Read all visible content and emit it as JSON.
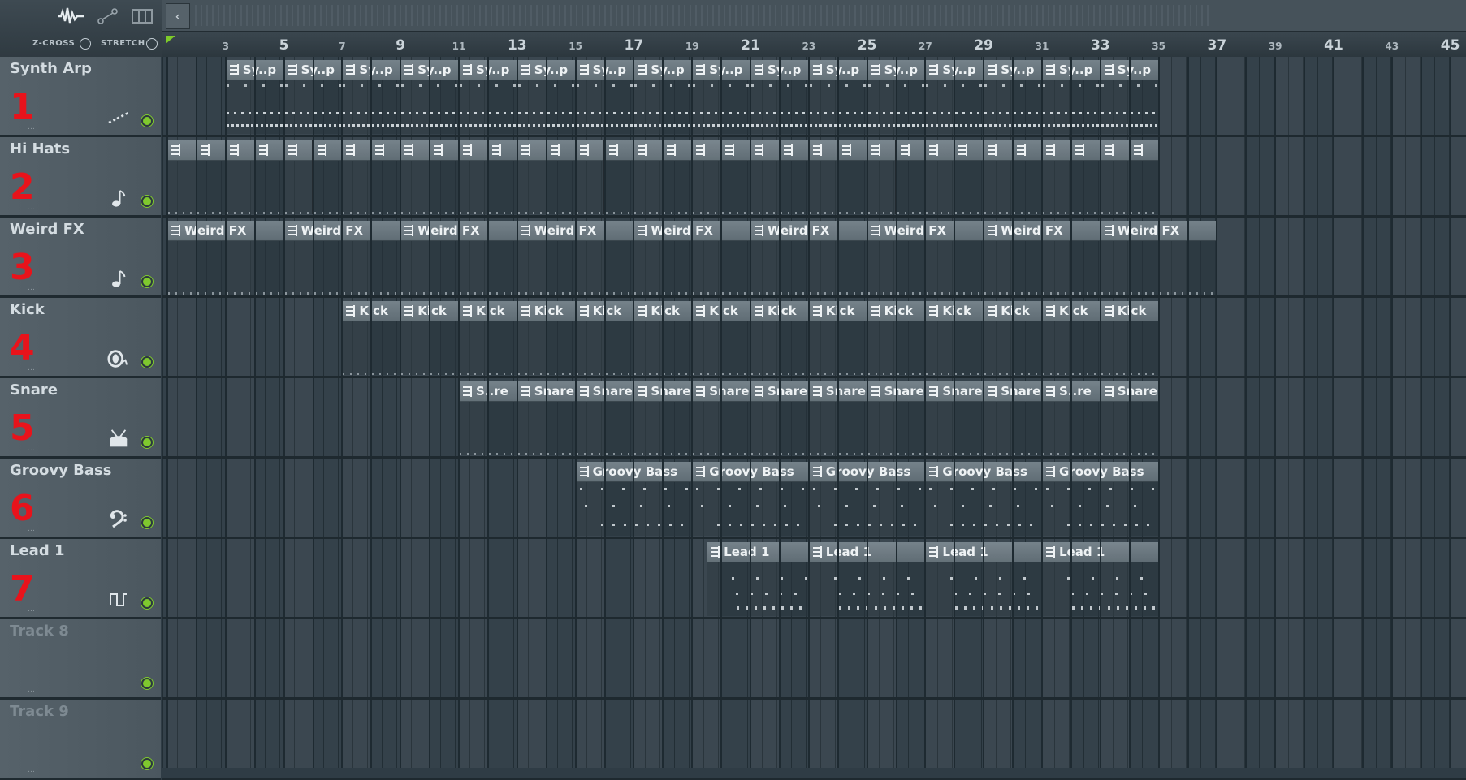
{
  "header": {
    "zcross_label": "Z-CROSS",
    "stretch_label": "STRETCH"
  },
  "ruler": {
    "labels": [
      "3",
      "5",
      "7",
      "9",
      "11",
      "13",
      "15",
      "17",
      "19",
      "21",
      "23",
      "25",
      "27",
      "29",
      "31",
      "33",
      "35",
      "37",
      "39",
      "41",
      "43",
      "45"
    ]
  },
  "tracks": [
    {
      "name": "Synth Arp",
      "number": "1",
      "icon": "arp-icon",
      "active": true
    },
    {
      "name": "Hi Hats",
      "number": "2",
      "icon": "note-icon",
      "active": true
    },
    {
      "name": "Weird FX",
      "number": "3",
      "icon": "note-icon",
      "active": true
    },
    {
      "name": "Kick",
      "number": "4",
      "icon": "kick-drum-icon",
      "active": true
    },
    {
      "name": "Snare",
      "number": "5",
      "icon": "snare-drum-icon",
      "active": true
    },
    {
      "name": "Groovy Bass",
      "number": "6",
      "icon": "bass-clef-icon",
      "active": true
    },
    {
      "name": "Lead 1",
      "number": "7",
      "icon": "square-wave-icon",
      "active": true
    },
    {
      "name": "Track 8",
      "number": "",
      "icon": "",
      "active": false
    },
    {
      "name": "Track 9",
      "number": "",
      "icon": "",
      "active": false
    }
  ],
  "clip_lanes": [
    {
      "track": "Synth Arp",
      "style": "synth",
      "clips": [
        {
          "label": "Sy..p",
          "start": 3,
          "length": 2
        },
        {
          "label": "Sy..p",
          "start": 5,
          "length": 2
        },
        {
          "label": "Sy..p",
          "start": 7,
          "length": 2
        },
        {
          "label": "Sy..p",
          "start": 9,
          "length": 2
        },
        {
          "label": "Sy..p",
          "start": 11,
          "length": 2
        },
        {
          "label": "Sy..p",
          "start": 13,
          "length": 2
        },
        {
          "label": "Sy..p",
          "start": 15,
          "length": 2
        },
        {
          "label": "Sy..p",
          "start": 17,
          "length": 2
        },
        {
          "label": "Sy..p",
          "start": 19,
          "length": 2
        },
        {
          "label": "Sy..p",
          "start": 21,
          "length": 2
        },
        {
          "label": "Sy..p",
          "start": 23,
          "length": 2
        },
        {
          "label": "Sy..p",
          "start": 25,
          "length": 2
        },
        {
          "label": "Sy..p",
          "start": 27,
          "length": 2
        },
        {
          "label": "Sy..p",
          "start": 29,
          "length": 2
        },
        {
          "label": "Sy..p",
          "start": 31,
          "length": 2
        },
        {
          "label": "Sy..p",
          "start": 33,
          "length": 2
        }
      ]
    },
    {
      "track": "Hi Hats",
      "style": "hat",
      "clips": [
        {
          "label": "",
          "start": 1,
          "length": 1
        },
        {
          "label": "",
          "start": 2,
          "length": 1
        },
        {
          "label": "",
          "start": 3,
          "length": 1
        },
        {
          "label": "",
          "start": 4,
          "length": 1
        },
        {
          "label": "",
          "start": 5,
          "length": 1
        },
        {
          "label": "",
          "start": 6,
          "length": 1
        },
        {
          "label": "",
          "start": 7,
          "length": 1
        },
        {
          "label": "",
          "start": 8,
          "length": 1
        },
        {
          "label": "",
          "start": 9,
          "length": 1
        },
        {
          "label": "",
          "start": 10,
          "length": 1
        },
        {
          "label": "",
          "start": 11,
          "length": 1
        },
        {
          "label": "",
          "start": 12,
          "length": 1
        },
        {
          "label": "",
          "start": 13,
          "length": 1
        },
        {
          "label": "",
          "start": 14,
          "length": 1
        },
        {
          "label": "",
          "start": 15,
          "length": 1
        },
        {
          "label": "",
          "start": 16,
          "length": 1
        },
        {
          "label": "",
          "start": 17,
          "length": 1
        },
        {
          "label": "",
          "start": 18,
          "length": 1
        },
        {
          "label": "",
          "start": 19,
          "length": 1
        },
        {
          "label": "",
          "start": 20,
          "length": 1
        },
        {
          "label": "",
          "start": 21,
          "length": 1
        },
        {
          "label": "",
          "start": 22,
          "length": 1
        },
        {
          "label": "",
          "start": 23,
          "length": 1
        },
        {
          "label": "",
          "start": 24,
          "length": 1
        },
        {
          "label": "",
          "start": 25,
          "length": 1
        },
        {
          "label": "",
          "start": 26,
          "length": 1
        },
        {
          "label": "",
          "start": 27,
          "length": 1
        },
        {
          "label": "",
          "start": 28,
          "length": 1
        },
        {
          "label": "",
          "start": 29,
          "length": 1
        },
        {
          "label": "",
          "start": 30,
          "length": 1
        },
        {
          "label": "",
          "start": 31,
          "length": 1
        },
        {
          "label": "",
          "start": 32,
          "length": 1
        },
        {
          "label": "",
          "start": 33,
          "length": 1
        },
        {
          "label": "",
          "start": 34,
          "length": 1
        }
      ]
    },
    {
      "track": "Weird FX",
      "style": "fx",
      "clips": [
        {
          "label": "Weird FX",
          "start": 1,
          "length": 4
        },
        {
          "label": "Weird FX",
          "start": 5,
          "length": 4
        },
        {
          "label": "Weird FX",
          "start": 9,
          "length": 4
        },
        {
          "label": "Weird FX",
          "start": 13,
          "length": 4
        },
        {
          "label": "Weird FX",
          "start": 17,
          "length": 4
        },
        {
          "label": "Weird FX",
          "start": 21,
          "length": 4
        },
        {
          "label": "Weird FX",
          "start": 25,
          "length": 4
        },
        {
          "label": "Weird FX",
          "start": 29,
          "length": 4
        },
        {
          "label": "Weird FX",
          "start": 33,
          "length": 4
        }
      ]
    },
    {
      "track": "Kick",
      "style": "kick",
      "clips": [
        {
          "label": "Kick",
          "start": 7,
          "length": 2
        },
        {
          "label": "Kick",
          "start": 9,
          "length": 2
        },
        {
          "label": "Kick",
          "start": 11,
          "length": 2
        },
        {
          "label": "Kick",
          "start": 13,
          "length": 2
        },
        {
          "label": "Kick",
          "start": 15,
          "length": 2
        },
        {
          "label": "Kick",
          "start": 17,
          "length": 2
        },
        {
          "label": "Kick",
          "start": 19,
          "length": 2
        },
        {
          "label": "Kick",
          "start": 21,
          "length": 2
        },
        {
          "label": "Kick",
          "start": 23,
          "length": 2
        },
        {
          "label": "Kick",
          "start": 25,
          "length": 2
        },
        {
          "label": "Kick",
          "start": 27,
          "length": 2
        },
        {
          "label": "Kick",
          "start": 29,
          "length": 2
        },
        {
          "label": "Kick",
          "start": 31,
          "length": 2
        },
        {
          "label": "Kick",
          "start": 33,
          "length": 2
        }
      ]
    },
    {
      "track": "Snare",
      "style": "snare",
      "clips": [
        {
          "label": "S..re",
          "start": 11,
          "length": 2
        },
        {
          "label": "Snare",
          "start": 13,
          "length": 2
        },
        {
          "label": "Snare",
          "start": 15,
          "length": 2
        },
        {
          "label": "Snare",
          "start": 17,
          "length": 2
        },
        {
          "label": "Snare",
          "start": 19,
          "length": 2
        },
        {
          "label": "Snare",
          "start": 21,
          "length": 2
        },
        {
          "label": "Snare",
          "start": 23,
          "length": 2
        },
        {
          "label": "Snare",
          "start": 25,
          "length": 2
        },
        {
          "label": "Snare",
          "start": 27,
          "length": 2
        },
        {
          "label": "Snare",
          "start": 29,
          "length": 2
        },
        {
          "label": "S..re",
          "start": 31,
          "length": 2
        },
        {
          "label": "Snare",
          "start": 33,
          "length": 2
        }
      ]
    },
    {
      "track": "Groovy Bass",
      "style": "bass",
      "clips": [
        {
          "label": "Groovy Bass",
          "start": 15,
          "length": 4
        },
        {
          "label": "Groovy Bass",
          "start": 19,
          "length": 4
        },
        {
          "label": "Groovy Bass",
          "start": 23,
          "length": 4
        },
        {
          "label": "Groovy Bass",
          "start": 27,
          "length": 4
        },
        {
          "label": "Groovy Bass",
          "start": 31,
          "length": 4
        }
      ]
    },
    {
      "track": "Lead 1",
      "style": "lead",
      "clips": [
        {
          "label": "Lead 1",
          "start": 19.5,
          "length": 3.5
        },
        {
          "label": "Lead 1",
          "start": 23,
          "length": 4
        },
        {
          "label": "Lead 1",
          "start": 27,
          "length": 4
        },
        {
          "label": "Lead 1",
          "start": 31,
          "length": 4
        }
      ]
    }
  ],
  "colors": {
    "track_number": "#e8131b",
    "mute_led": "#7fc92e",
    "clip_header": "#6c7981"
  }
}
